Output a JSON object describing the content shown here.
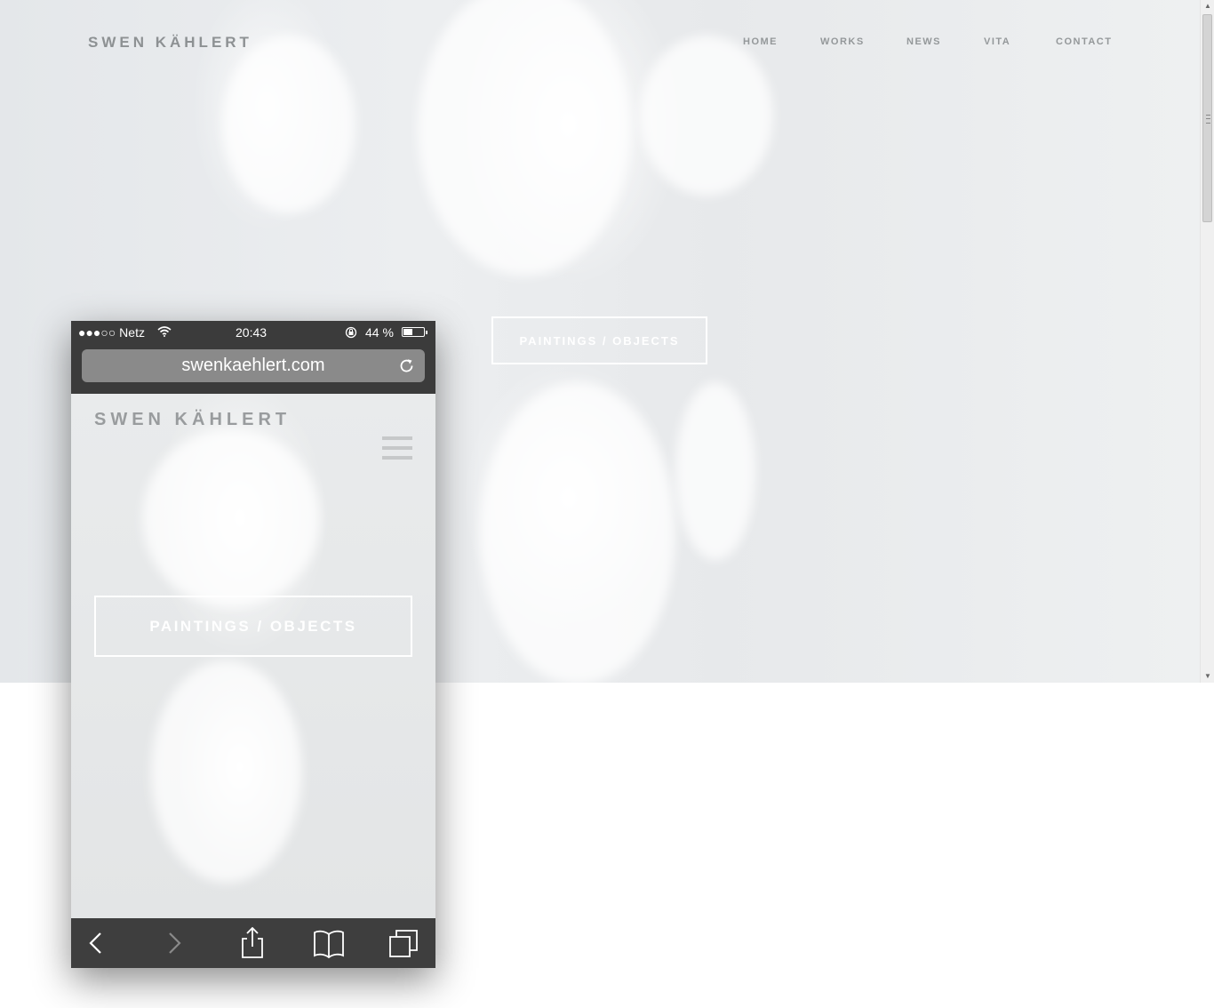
{
  "desktop": {
    "brand": "SWEN KÄHLERT",
    "nav": [
      {
        "label": "HOME"
      },
      {
        "label": "WORKS"
      },
      {
        "label": "NEWS"
      },
      {
        "label": "VITA"
      },
      {
        "label": "CONTACT"
      }
    ],
    "hero_button": "PAINTINGS / OBJECTS"
  },
  "mobile": {
    "status": {
      "signal_carrier": "●●●○○ Netz",
      "time": "20:43",
      "battery_text": "44 %",
      "battery_level": 0.44
    },
    "url": "swenkaehlert.com",
    "brand": "SWEN KÄHLERT",
    "hero_button": "PAINTINGS / OBJECTS",
    "toolbar_icons": [
      "back-icon",
      "forward-icon",
      "share-icon",
      "bookmarks-icon",
      "tabs-icon"
    ]
  },
  "colors": {
    "hero_bg": "#e6e8ea",
    "nav_text": "#94989a",
    "phone_chrome": "#3b3b3b",
    "url_bar": "#8a8a8a"
  }
}
